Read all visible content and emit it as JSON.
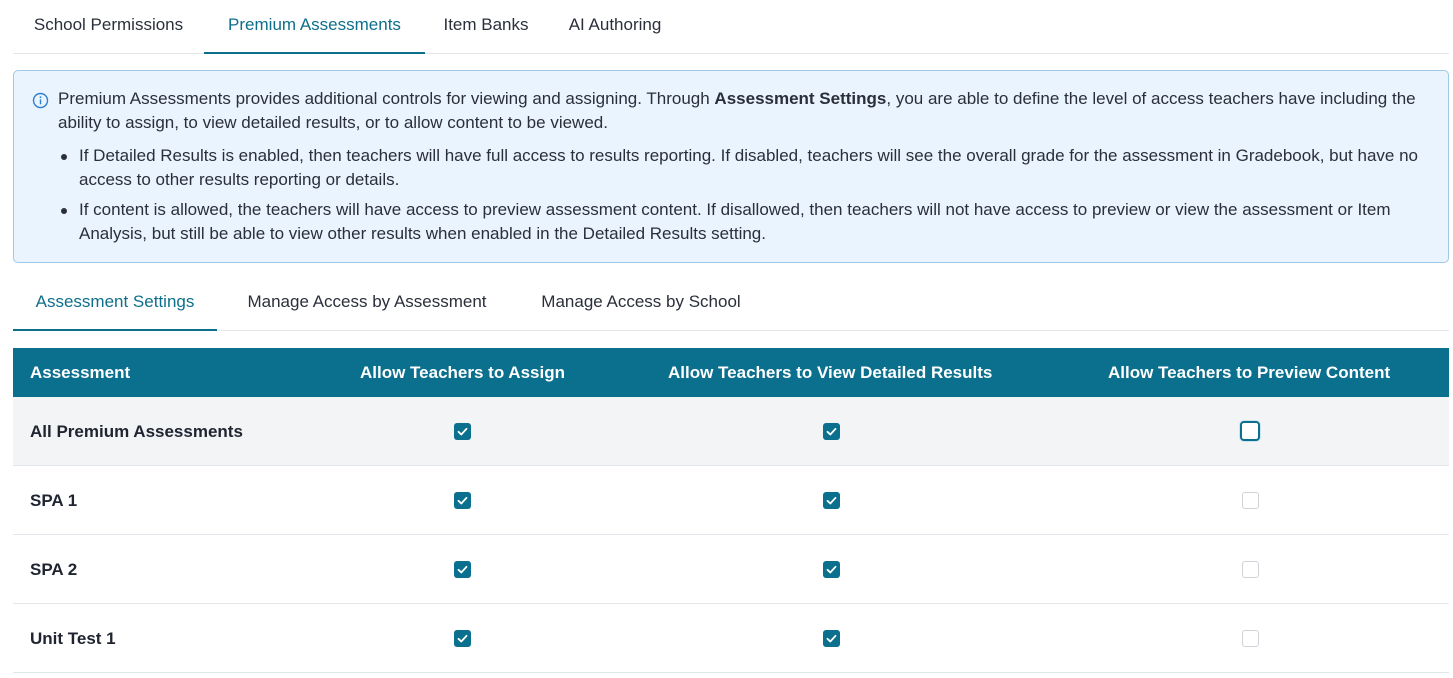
{
  "top_tabs": [
    {
      "label": "School Permissions",
      "active": false
    },
    {
      "label": "Premium Assessments",
      "active": true
    },
    {
      "label": "Item Banks",
      "active": false
    },
    {
      "label": "AI Authoring",
      "active": false
    }
  ],
  "info": {
    "intro_before": "Premium Assessments provides additional controls for viewing and assigning. Through ",
    "intro_bold": "Assessment Settings",
    "intro_after": ", you are able to define the level of access teachers have including the ability to assign, to view detailed results, or to allow content to be viewed.",
    "bullets": [
      "If Detailed Results is enabled, then teachers will have full access to results reporting. If disabled, teachers will see the overall grade for the assessment in Gradebook, but have no access to other results reporting or details.",
      "If content is allowed, the teachers will have access to preview assessment content. If disallowed, then teachers will not have access to preview or view the assessment or Item Analysis, but still be able to view other results when enabled in the Detailed Results setting."
    ]
  },
  "sub_tabs": [
    {
      "label": "Assessment Settings",
      "active": true
    },
    {
      "label": "Manage Access by Assessment",
      "active": false
    },
    {
      "label": "Manage Access by School",
      "active": false
    }
  ],
  "table": {
    "headers": [
      "Assessment",
      "Allow Teachers to Assign",
      "Allow Teachers to View Detailed Results",
      "Allow Teachers to Preview Content"
    ],
    "rows": [
      {
        "name": "All Premium Assessments",
        "assign": true,
        "view_results": true,
        "preview": false
      },
      {
        "name": "SPA 1",
        "assign": true,
        "view_results": true,
        "preview": false
      },
      {
        "name": "SPA 2",
        "assign": true,
        "view_results": true,
        "preview": false
      },
      {
        "name": "Unit Test 1",
        "assign": true,
        "view_results": true,
        "preview": false
      }
    ]
  },
  "colors": {
    "accent": "#0e6f8a",
    "header_bg": "#0b6f8e",
    "info_bg": "#eaf4fe",
    "info_border": "#9fc9e6"
  },
  "icons": {
    "info": "info-circle-icon",
    "checked": "check-icon"
  }
}
